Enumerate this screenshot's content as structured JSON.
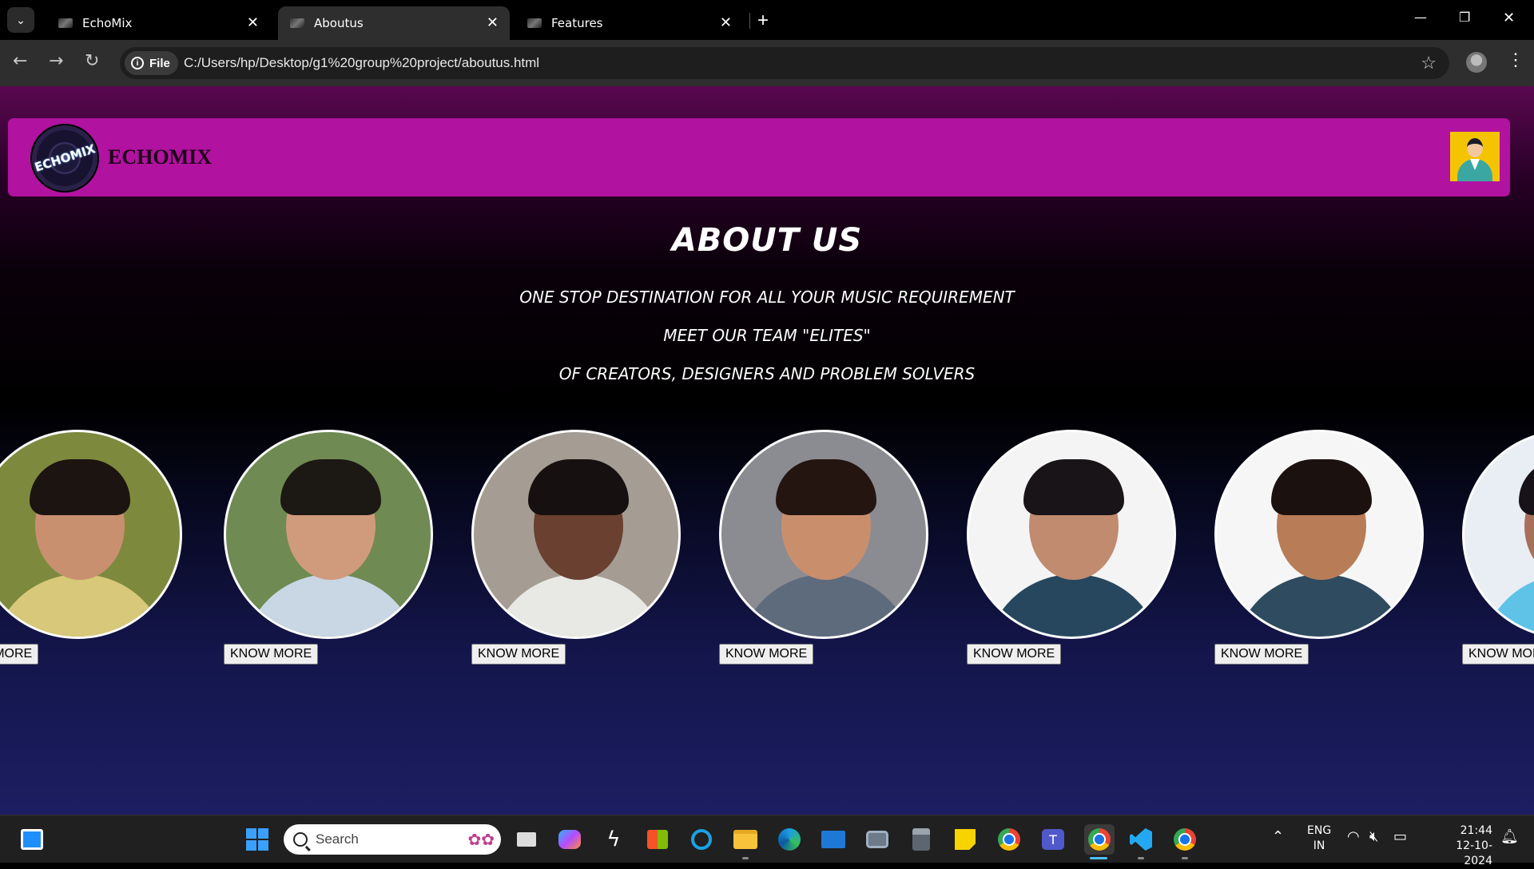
{
  "browser": {
    "tabs": [
      {
        "title": "EchoMix",
        "active": false
      },
      {
        "title": "Aboutus",
        "active": true
      },
      {
        "title": "Features",
        "active": false
      }
    ],
    "address": {
      "chip_label": "File",
      "url": "C:/Users/hp/Desktop/g1%20group%20project/aboutus.html"
    }
  },
  "site": {
    "brand": "ECHOMIX",
    "logo_text": "ECHOMIX",
    "header_color": "#b1129f",
    "title": "ABOUT US",
    "lines": [
      "ONE STOP DESTINATION FOR ALL YOUR MUSIC REQUIREMENT",
      "MEET OUR TEAM \"ELITES\"",
      "OF CREATORS, DESIGNERS AND PROBLEM SOLVERS"
    ],
    "team": [
      {
        "button": "KNOW MORE",
        "bg": "#7d8a3e",
        "skin": "#c99070",
        "hair": "#1c1410",
        "shirt": "#d8c87a"
      },
      {
        "button": "KNOW MORE",
        "bg": "#6f8a52",
        "skin": "#d09b7c",
        "hair": "#1c1814",
        "shirt": "#c9d6e4"
      },
      {
        "button": "KNOW MORE",
        "bg": "#a59d93",
        "skin": "#6a4030",
        "hair": "#161010",
        "shirt": "#e8e8e4"
      },
      {
        "button": "KNOW MORE",
        "bg": "#8b8b92",
        "skin": "#c98f6d",
        "hair": "#241510",
        "shirt": "#5e6b7d"
      },
      {
        "button": "KNOW MORE",
        "bg": "#f4f4f4",
        "skin": "#c08b6f",
        "hair": "#181418",
        "shirt": "#27475e"
      },
      {
        "button": "KNOW MORE",
        "bg": "#f6f6f6",
        "skin": "#b87d56",
        "hair": "#1b1210",
        "shirt": "#2e4b60"
      },
      {
        "button": "KNOW MORE",
        "bg": "#e9eef4",
        "skin": "#a8705a",
        "hair": "#161218",
        "shirt": "#5fc3e8"
      }
    ]
  },
  "taskbar": {
    "search_placeholder": "Search",
    "lang_top": "ENG",
    "lang_bottom": "IN",
    "time": "21:44",
    "date": "12-10-2024"
  }
}
